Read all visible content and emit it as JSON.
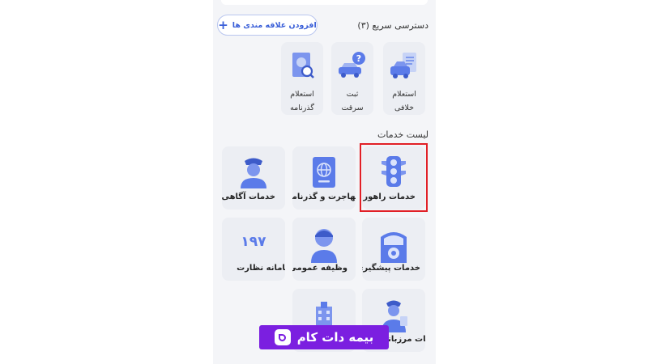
{
  "quick_access": {
    "title": "دسترسی سریع (۳)",
    "add_button": "افزودن علاقه مندی ها",
    "items": [
      {
        "label_1": "استعلام",
        "label_2": "خلافی",
        "icon": "traffic-fine-receipt-icon"
      },
      {
        "label_1": "ثبت",
        "label_2": "سرقت",
        "icon": "car-question-icon"
      },
      {
        "label_1": "استعلام",
        "label_2": "گذرنامه",
        "icon": "passport-search-icon"
      }
    ]
  },
  "services": {
    "title": "لیست خدمات",
    "items": [
      {
        "label": "خدمات راهور",
        "icon": "traffic-light-icon",
        "highlighted": true
      },
      {
        "label": "مهاجرت و گذرنامه",
        "icon": "passport-globe-icon"
      },
      {
        "label": "خدمات آگاهی",
        "icon": "police-officer-icon"
      },
      {
        "label": "خدمات پیشگیری",
        "icon": "police-station-badge-icon"
      },
      {
        "label": "وظیفه عمومی",
        "icon": "soldier-avatar-icon"
      },
      {
        "label": "سامانه نظارت",
        "number": "۱۹۷",
        "icon": "hotline-197-icon"
      },
      {
        "label": "خدمات مرزبانی",
        "icon": "border-guard-icon"
      },
      {
        "label": "",
        "icon": "building-icon"
      }
    ]
  },
  "watermark": {
    "text": "بیمه دات کام",
    "icon": "bimeh-logo-icon"
  },
  "colors": {
    "accent": "#5b7be9",
    "highlight": "#e11f26",
    "brand": "#7b1fe0"
  }
}
